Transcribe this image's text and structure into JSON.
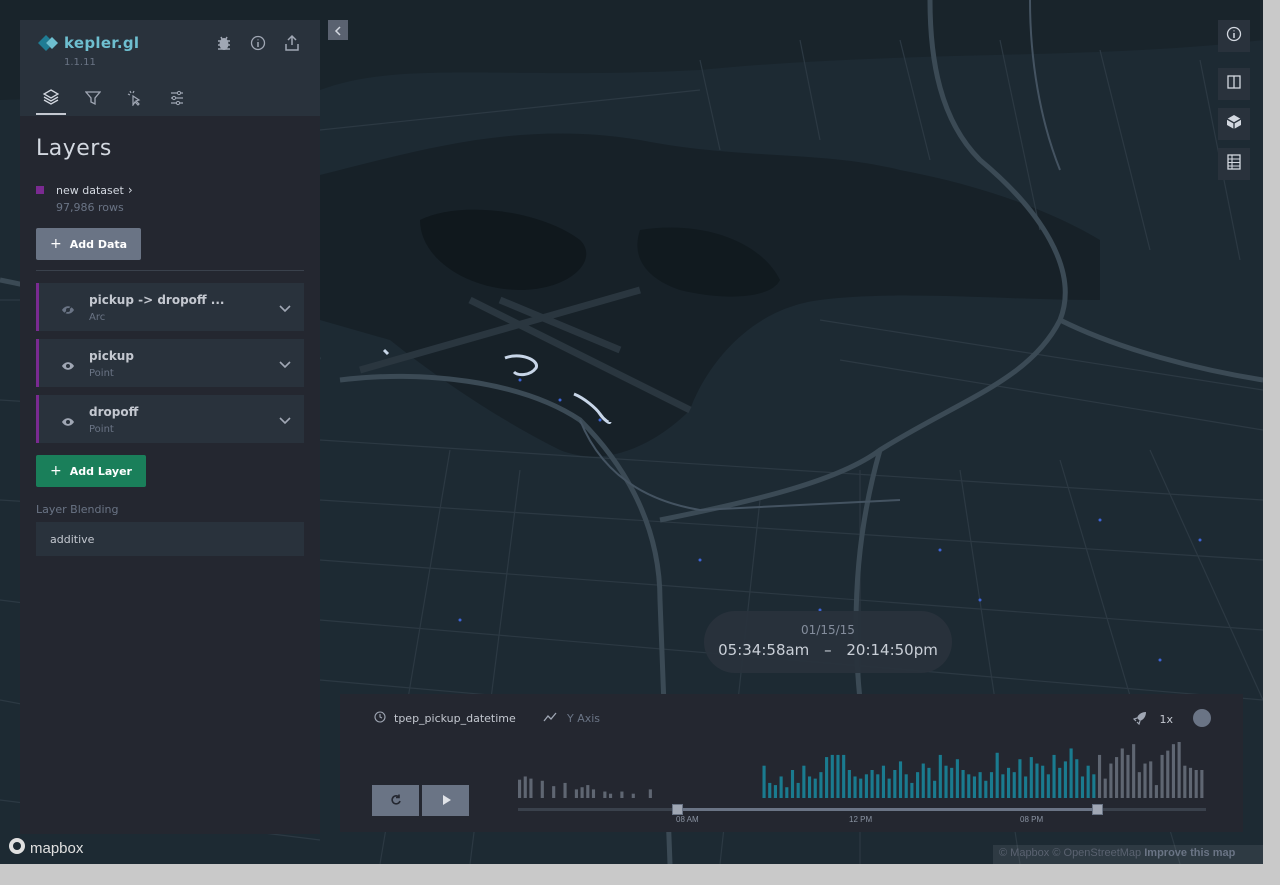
{
  "header": {
    "app_name": "kepler.gl",
    "version": "1.1.11",
    "icons": [
      "bug-icon",
      "info-icon",
      "share-icon"
    ],
    "tabs": [
      {
        "name": "layers",
        "icon": "layers-icon",
        "active": true
      },
      {
        "name": "filters",
        "icon": "filter-icon",
        "active": false
      },
      {
        "name": "interactions",
        "icon": "cursor-click-icon",
        "active": false
      },
      {
        "name": "map-settings",
        "icon": "sliders-icon",
        "active": false
      }
    ]
  },
  "panel": {
    "title": "Layers",
    "dataset": {
      "name": "new dataset",
      "rows": "97,986 rows",
      "color": "#7a2a91"
    },
    "add_data_label": "Add Data",
    "layers": [
      {
        "name": "pickup -> dropoff ...",
        "type": "Arc",
        "visible": false
      },
      {
        "name": "pickup",
        "type": "Point",
        "visible": true
      },
      {
        "name": "dropoff",
        "type": "Point",
        "visible": true
      }
    ],
    "add_layer_label": "Add Layer",
    "blending_label": "Layer Blending",
    "blending_value": "additive"
  },
  "map_controls": [
    "info-icon",
    "split-map-icon",
    "3d-view-icon",
    "legend-icon"
  ],
  "time_display": {
    "date": "01/15/15",
    "start": "05:34:58am",
    "separator": "–",
    "end": "20:14:50pm"
  },
  "timeline": {
    "field_name": "tpep_pickup_datetime",
    "y_axis_label": "Y Axis",
    "speed": "1x",
    "ticks": [
      "08 AM",
      "12 PM",
      "08 PM"
    ],
    "histogram": [
      17,
      20,
      18,
      0,
      16,
      0,
      11,
      0,
      14,
      0,
      8,
      10,
      12,
      8,
      0,
      6,
      4,
      0,
      6,
      0,
      4,
      0,
      0,
      8,
      0,
      0,
      0,
      0,
      0,
      0,
      0,
      0,
      0,
      0,
      0,
      0,
      0,
      0,
      0,
      0,
      0,
      0,
      0,
      30,
      14,
      12,
      20,
      10,
      26,
      14,
      30,
      20,
      18,
      24,
      38,
      40,
      40,
      40,
      26,
      20,
      18,
      22,
      26,
      22,
      30,
      18,
      26,
      34,
      22,
      14,
      24,
      32,
      28,
      16,
      40,
      30,
      28,
      36,
      26,
      22,
      20,
      24,
      16,
      24,
      42,
      22,
      28,
      24,
      36,
      20,
      38,
      32,
      30,
      22,
      40,
      28,
      34,
      46,
      36,
      20,
      30,
      22,
      40,
      18,
      32,
      38,
      46,
      40,
      50,
      24,
      32,
      34,
      12,
      40,
      44,
      50,
      52,
      30,
      28,
      26,
      26
    ],
    "selection_start_fraction": 0.231,
    "selection_end_fraction": 0.84,
    "colors": {
      "active": "#1a7b8f",
      "inactive": "#5f6672"
    }
  },
  "footer": {
    "mapbox_label": "mapbox",
    "attribution": "© Mapbox © OpenStreetMap",
    "improve": "Improve this map"
  }
}
